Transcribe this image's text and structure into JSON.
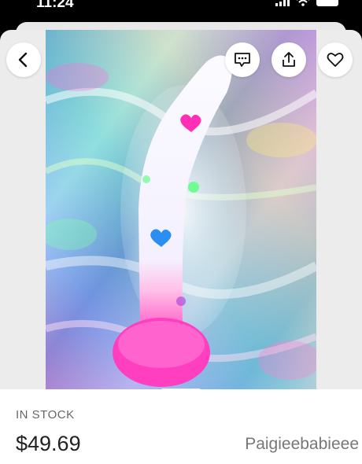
{
  "status_bar": {
    "time": "11:24",
    "icons": [
      "signal-icon",
      "wifi-icon",
      "battery-icon"
    ]
  },
  "toolbar": {
    "back_icon": "chevron-left-icon",
    "message_icon": "message-icon",
    "share_icon": "share-icon",
    "favorite_icon": "heart-icon"
  },
  "product": {
    "image_alt": "",
    "stock_status": "IN STOCK",
    "price": "$49.69",
    "seller": "Paigieebabieee"
  },
  "colors": {
    "background": "#000000",
    "sheet": "#ececec",
    "info_panel": "#ffffff",
    "stock_text": "#666666",
    "price_text": "#222222",
    "seller_text": "#777777"
  }
}
